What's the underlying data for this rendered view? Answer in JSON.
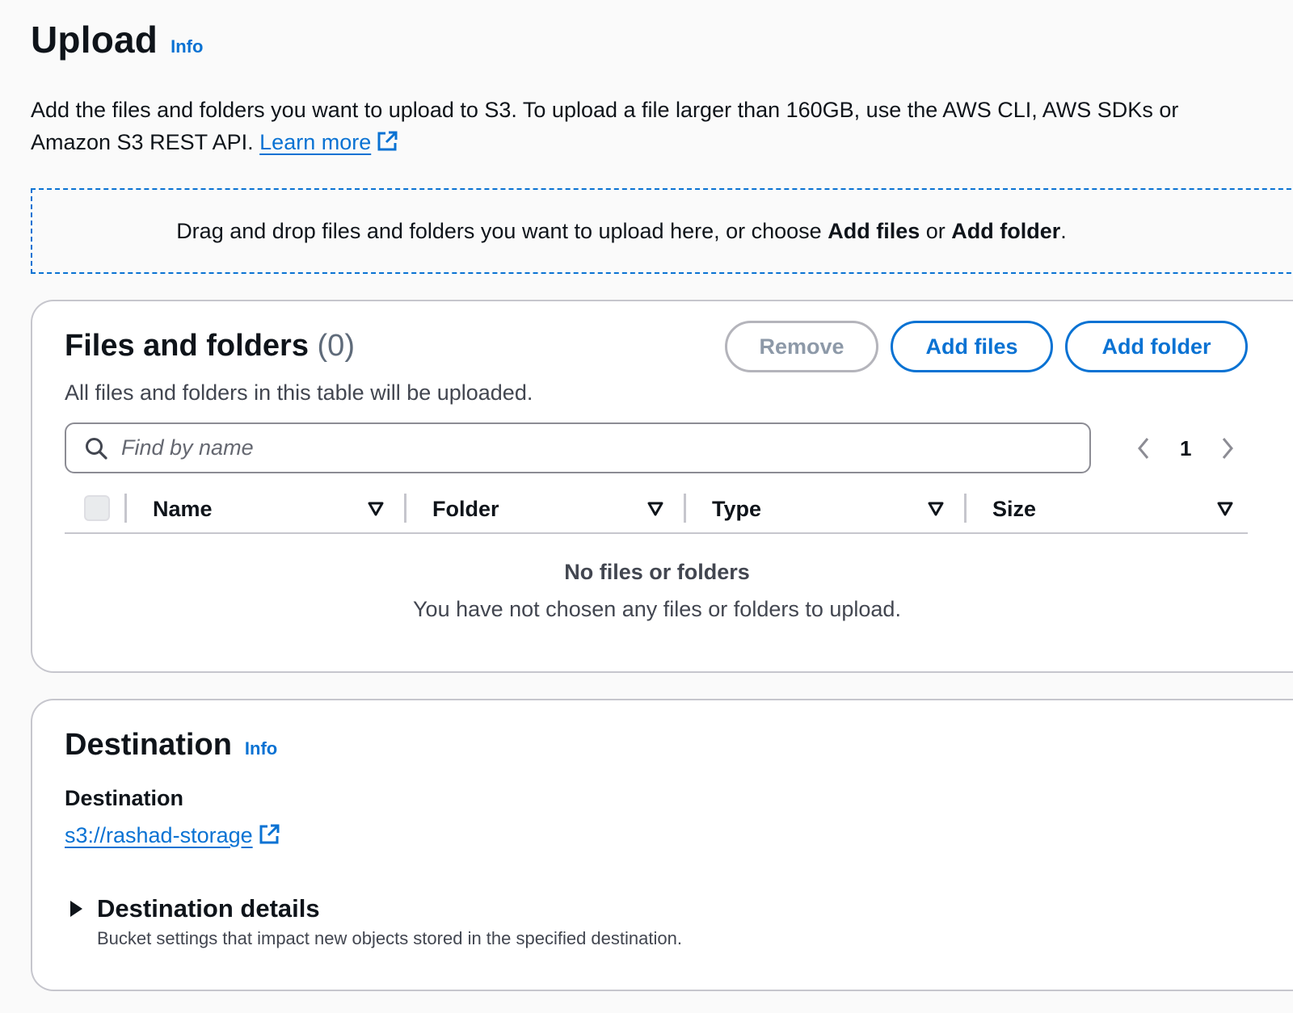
{
  "header": {
    "title": "Upload",
    "info": "Info"
  },
  "description": {
    "text": "Add the files and folders you want to upload to S3. To upload a file larger than 160GB, use the AWS CLI, AWS SDKs or Amazon S3 REST API.",
    "learn_more": "Learn more"
  },
  "dropzone": {
    "prefix": "Drag and drop files and folders you want to upload here, or choose",
    "add_files": "Add files",
    "or": "or",
    "add_folder": "Add folder",
    "suffix": "."
  },
  "files": {
    "title": "Files and folders",
    "count": "(0)",
    "subtitle": "All files and folders in this table will be uploaded.",
    "buttons": {
      "remove": "Remove",
      "add_files": "Add files",
      "add_folder": "Add folder"
    },
    "search": {
      "placeholder": "Find by name",
      "value": ""
    },
    "pagination": {
      "current_page": "1"
    },
    "columns": [
      "Name",
      "Folder",
      "Type",
      "Size"
    ],
    "empty": {
      "title": "No files or folders",
      "text": "You have not chosen any files or folders to upload."
    }
  },
  "destination": {
    "title": "Destination",
    "info": "Info",
    "label": "Destination",
    "link": "s3://rashad-storage",
    "details_title": "Destination details",
    "details_desc": "Bucket settings that impact new objects stored in the specified destination."
  },
  "icons": {
    "search": "search-icon",
    "external": "external-link-icon",
    "sort": "sort-down-icon",
    "prev": "chevron-left-icon",
    "next": "chevron-right-icon",
    "caret": "caret-right-icon"
  },
  "colors": {
    "link": "#0972d3",
    "text": "#0f141a",
    "muted": "#424650",
    "border": "#c6c6cd"
  }
}
